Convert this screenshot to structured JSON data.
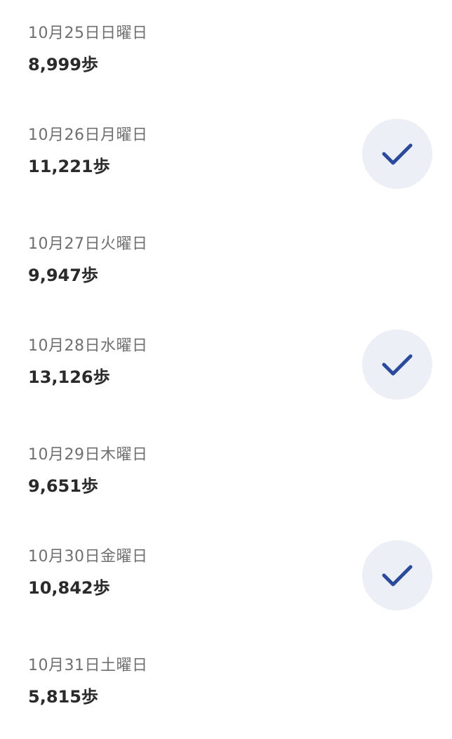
{
  "days": [
    {
      "date": "10月25日日曜日",
      "steps": "8,999歩",
      "goal_met": false
    },
    {
      "date": "10月26日月曜日",
      "steps": "11,221歩",
      "goal_met": true
    },
    {
      "date": "10月27日火曜日",
      "steps": "9,947歩",
      "goal_met": false
    },
    {
      "date": "10月28日水曜日",
      "steps": "13,126歩",
      "goal_met": true
    },
    {
      "date": "10月29日木曜日",
      "steps": "9,651歩",
      "goal_met": false
    },
    {
      "date": "10月30日金曜日",
      "steps": "10,842歩",
      "goal_met": true
    },
    {
      "date": "10月31日土曜日",
      "steps": "5,815歩",
      "goal_met": false
    }
  ],
  "colors": {
    "check": "#2b4a9c",
    "badge_bg": "#eceff6"
  },
  "icons": {
    "goal": "checkmark-icon"
  }
}
